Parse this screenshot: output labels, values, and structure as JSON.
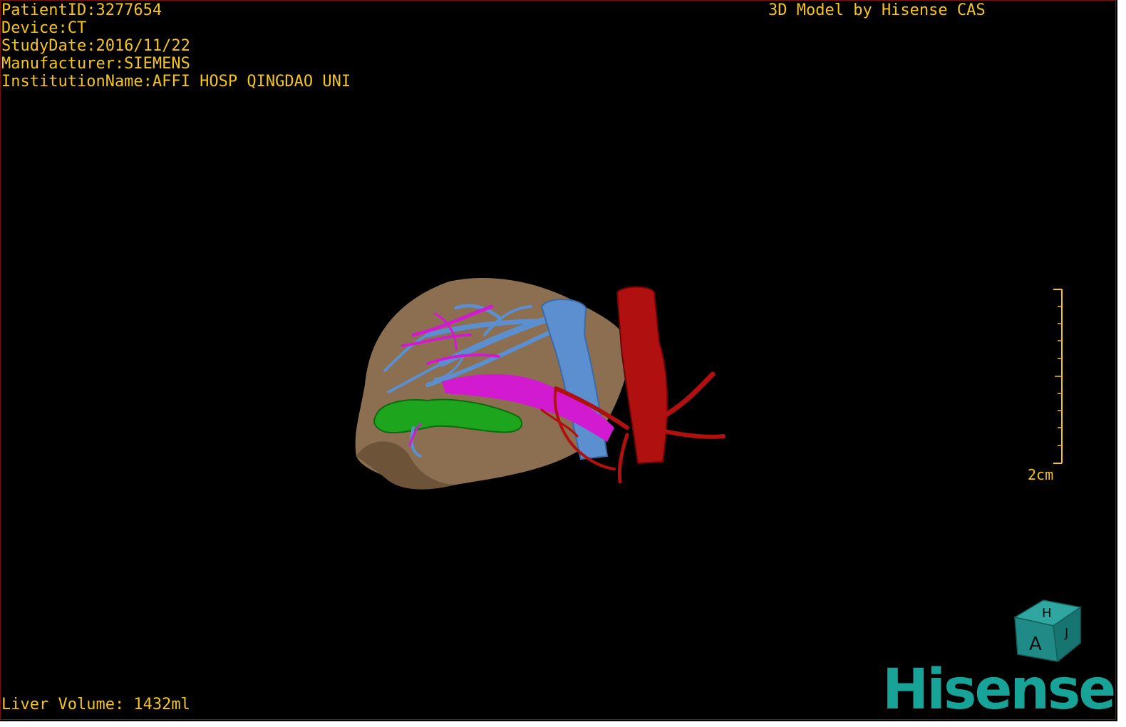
{
  "info": {
    "patient_id": "PatientID:3277654",
    "device": "Device:CT",
    "study_date": "StudyDate:2016/11/22",
    "manufacturer": "Manufacturer:SIEMENS",
    "institution": "InstitutionName:AFFI HOSP QINGDAO UNI"
  },
  "title": "3D Model by Hisense CAS",
  "liver_volume": "Liver Volume: 1432ml",
  "scale_label": "2cm",
  "orientation_cube": {
    "top": "H",
    "front": "A",
    "side": "J"
  },
  "logo_text": "Hisense",
  "colors": {
    "text": "#f5c518",
    "liver": "#8c7050",
    "portal_vein": "#5b8fd0",
    "hepatic_vein": "#d21bd0",
    "gallbladder": "#1ea51e",
    "artery": "#b01010",
    "logo": "#17a398"
  }
}
